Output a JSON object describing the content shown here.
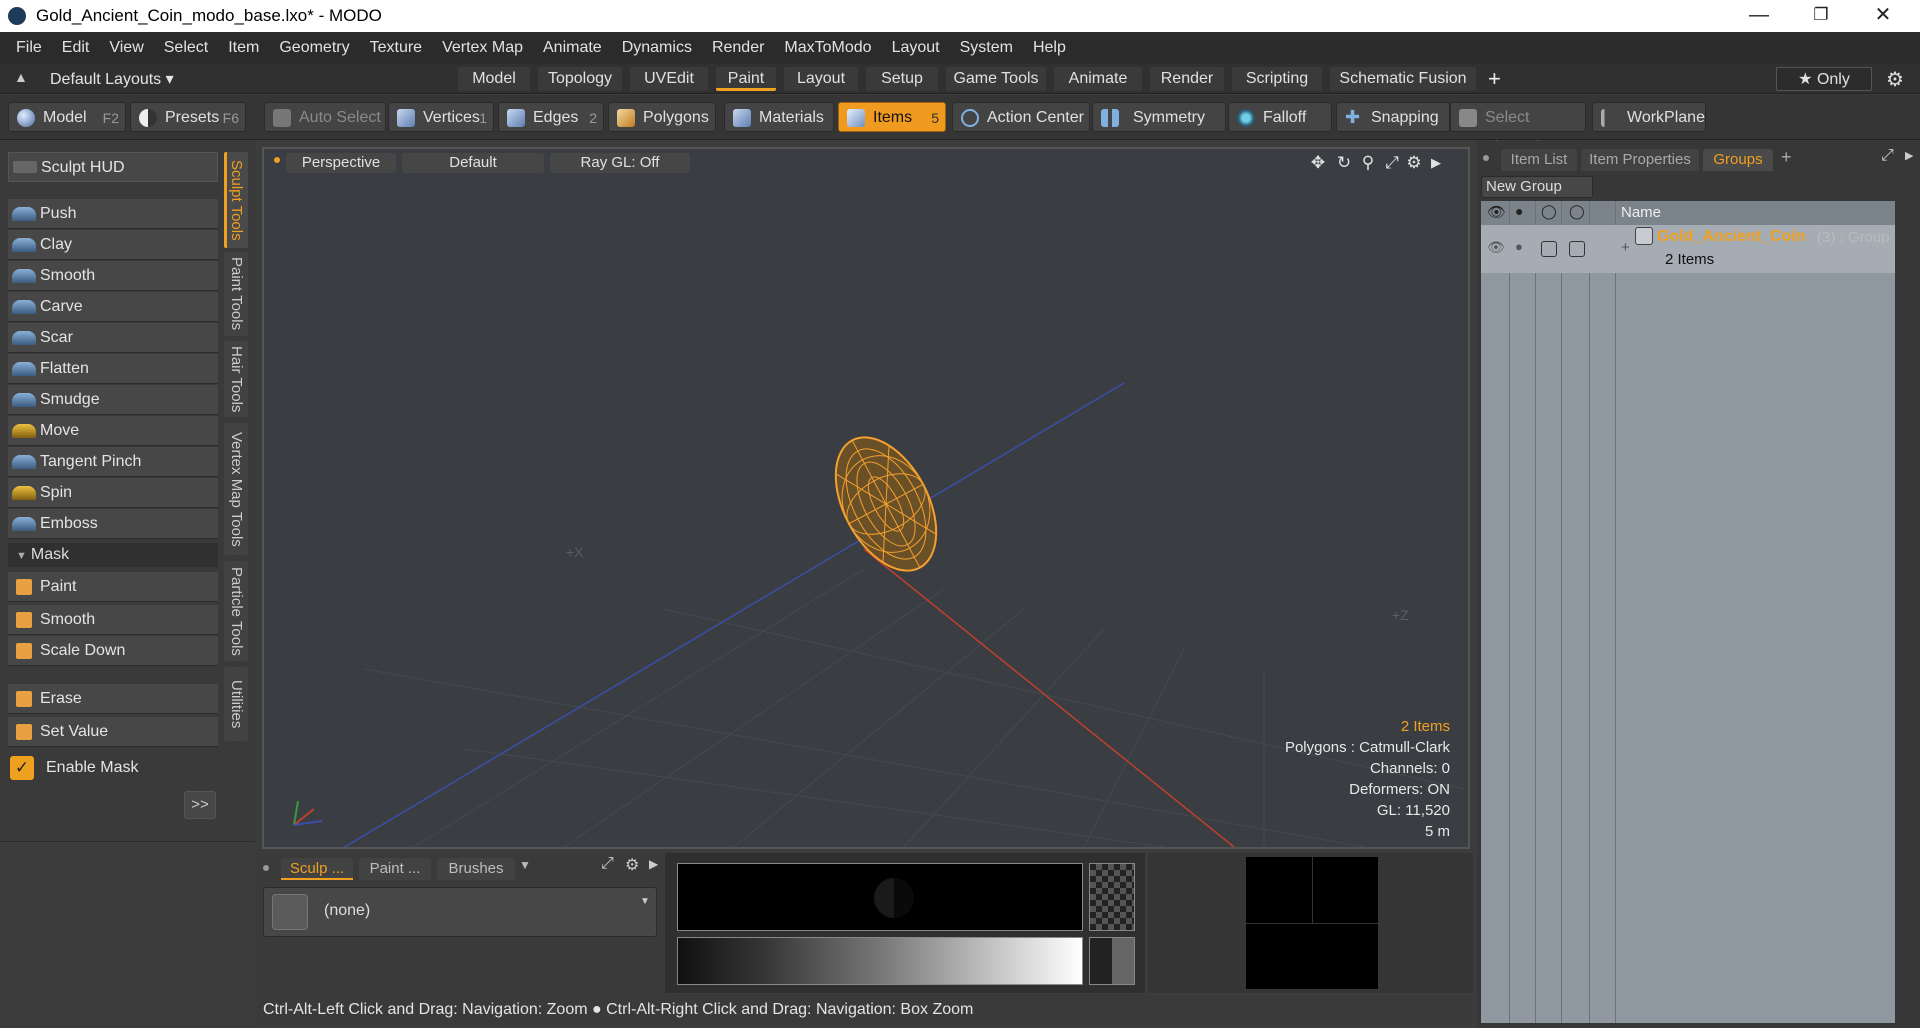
{
  "window": {
    "title": "Gold_Ancient_Coin_modo_base.lxo* - MODO",
    "minimize_glyph": "—",
    "restore_glyph": "❐",
    "close_glyph": "✕"
  },
  "menu": [
    "File",
    "Edit",
    "View",
    "Select",
    "Item",
    "Geometry",
    "Texture",
    "Vertex Map",
    "Animate",
    "Dynamics",
    "Render",
    "MaxToModo",
    "Layout",
    "System",
    "Help"
  ],
  "layout_bar": {
    "layouts_label": "Default Layouts ▾",
    "tabs": [
      "Model",
      "Topology",
      "UVEdit",
      "Paint",
      "Layout",
      "Setup",
      "Game Tools",
      "Animate",
      "Render",
      "Scripting",
      "Schematic Fusion"
    ],
    "active_tab": "Paint",
    "add_glyph": "+",
    "only_label": "★ Only"
  },
  "toolbar": {
    "model": "Model",
    "model_key": "F2",
    "presets": "Presets",
    "presets_key": "F6",
    "auto_select": "Auto Select",
    "vertices": "Vertices",
    "vertices_num": "1",
    "edges": "Edges",
    "edges_num": "2",
    "polygons": "Polygons",
    "materials": "Materials",
    "items": "Items",
    "items_num": "5",
    "action_center": "Action Center",
    "symmetry": "Symmetry",
    "falloff": "Falloff",
    "snapping": "Snapping",
    "select_through": "Select Through",
    "workplane": "WorkPlane"
  },
  "left_panel": {
    "sculpt_hud": "Sculpt HUD",
    "tools": [
      "Push",
      "Clay",
      "Smooth",
      "Carve",
      "Scar",
      "Flatten",
      "Smudge",
      "Move",
      "Tangent Pinch",
      "Spin",
      "Emboss"
    ],
    "mask_header": "Mask",
    "mask_tools": [
      "Paint",
      "Smooth",
      "Scale Down"
    ],
    "erase": "Erase",
    "set_value": "Set Value",
    "enable_mask": "Enable Mask",
    "expand_glyph": ">>",
    "vertical_tabs": [
      "Sculpt Tools",
      "Paint Tools",
      "Hair Tools",
      "Vertex Map Tools",
      "Particle Tools",
      "Utilities"
    ]
  },
  "viewport": {
    "view_mode": "Perspective",
    "shading": "Default",
    "raygl": "Ray GL: Off",
    "axis_x": "+X",
    "axis_z": "+Z",
    "info": {
      "items": "2 Items",
      "polygons": "Polygons : Catmull-Clark",
      "channels": "Channels: 0",
      "deformers": "Deformers: ON",
      "gl": "GL: 11,520",
      "scale": "5 m"
    }
  },
  "bottom_panel": {
    "tabs": [
      "Sculp ...",
      "Paint ...",
      "Brushes"
    ],
    "brush_value": "(none)"
  },
  "status_bar": "Ctrl-Alt-Left Click and Drag: Navigation: Zoom ● Ctrl-Alt-Right Click and Drag: Navigation: Box Zoom",
  "right_panel": {
    "tabs": [
      "Item List",
      "Item Properties",
      "Groups"
    ],
    "active_tab": "Groups",
    "new_group": "New Group",
    "name_header": "Name",
    "group": {
      "name": "Gold_Ancient_Coin",
      "suffix": "(3) : Group",
      "sub": "2 Items"
    }
  },
  "colors": {
    "accent": "#f0a020",
    "wireframe": "#f5a030",
    "axis_red": "#c0402c",
    "axis_blue": "#3c4ea8"
  }
}
